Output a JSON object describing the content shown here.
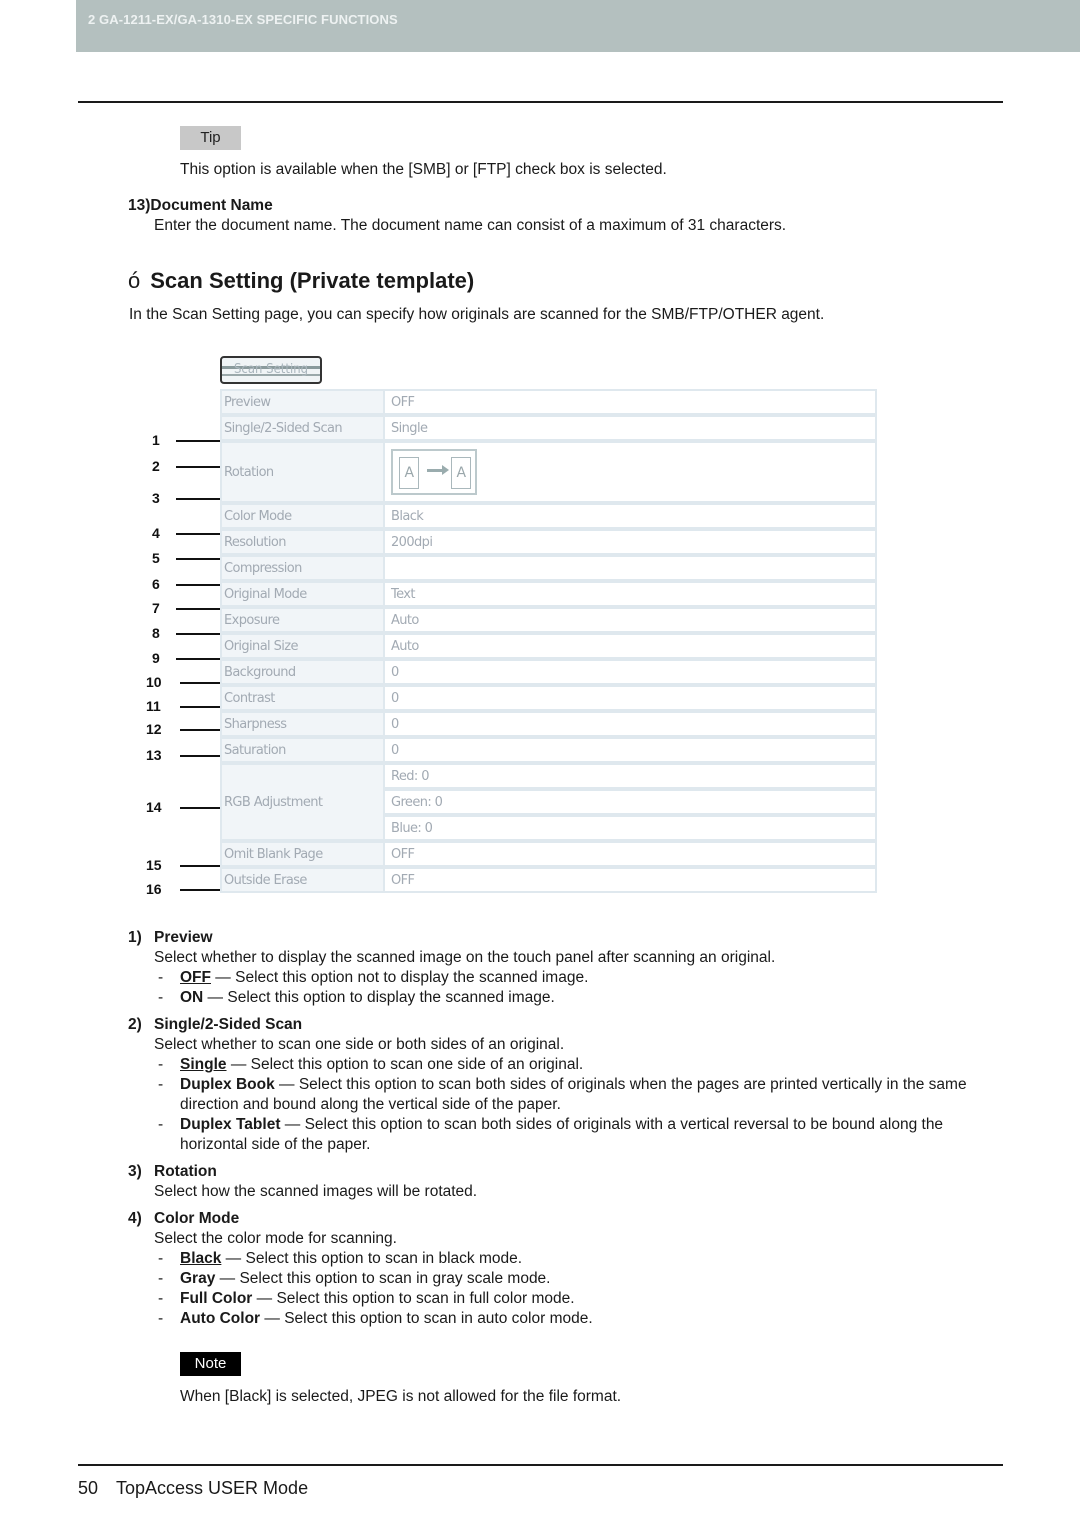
{
  "header": {
    "section_title": "2 GA-1211-EX/GA-1310-EX SPECIFIC FUNCTIONS"
  },
  "tip": {
    "label": "Tip",
    "text": "This option is available when the [SMB] or [FTP] check box is selected."
  },
  "item13": {
    "number": "13)",
    "title": "Document Name",
    "text": "Enter the document name. The document name can consist of a maximum of 31 characters."
  },
  "section": {
    "glyph": "ó",
    "title": "Scan Setting (Private template)",
    "intro": "In the Scan Setting page, you can specify how originals are scanned for the SMB/FTP/OTHER agent."
  },
  "screenshot": {
    "tab_label": "Scan Setting",
    "rows": [
      {
        "label": "Preview",
        "value": "OFF"
      },
      {
        "label": "Single/2-Sided Scan",
        "value": "Single"
      },
      {
        "label": "Rotation",
        "value": "",
        "icon": "rotation-icon",
        "icon_letters": [
          "A",
          "A"
        ]
      },
      {
        "label": "Color Mode",
        "value": "Black"
      },
      {
        "label": "Resolution",
        "value": "200dpi"
      },
      {
        "label": "Compression",
        "value": ""
      },
      {
        "label": "Original Mode",
        "value": "Text"
      },
      {
        "label": "Exposure",
        "value": "Auto"
      },
      {
        "label": "Original Size",
        "value": "Auto"
      },
      {
        "label": "Background",
        "value": "0"
      },
      {
        "label": "Contrast",
        "value": "0"
      },
      {
        "label": "Sharpness",
        "value": "0"
      },
      {
        "label": "Saturation",
        "value": "0"
      },
      {
        "label": "RGB Adjustment",
        "values": [
          "Red: 0",
          "Green: 0",
          "Blue: 0"
        ]
      },
      {
        "label": "Omit Blank Page",
        "value": "OFF"
      },
      {
        "label": "Outside Erase",
        "value": "OFF"
      }
    ],
    "callouts": [
      "1",
      "2",
      "3",
      "4",
      "5",
      "6",
      "7",
      "8",
      "9",
      "10",
      "11",
      "12",
      "13",
      "14",
      "15",
      "16"
    ]
  },
  "descriptions": [
    {
      "number": "1)",
      "title": "Preview",
      "text": "Select whether to display the scanned image on the touch panel after scanning an original.",
      "options": [
        {
          "name": "OFF",
          "default": true,
          "text": " — Select this option not to display the scanned image."
        },
        {
          "name": "ON",
          "default": false,
          "text": " — Select this option to display the scanned image."
        }
      ]
    },
    {
      "number": "2)",
      "title": "Single/2-Sided Scan",
      "text": "Select whether to scan one side or both sides of an original.",
      "options": [
        {
          "name": "Single",
          "default": true,
          "text": " — Select this option to scan one side of an original."
        },
        {
          "name": "Duplex Book",
          "default": false,
          "text": " — Select this option to scan both sides of originals when the pages are printed vertically in the same",
          "cont": "direction and bound along the vertical side of the paper."
        },
        {
          "name": "Duplex Tablet",
          "default": false,
          "text": " — Select this option to scan both sides of originals with a vertical reversal to be bound along the",
          "cont": "horizontal side of the paper."
        }
      ]
    },
    {
      "number": "3)",
      "title": "Rotation",
      "text": "Select how the scanned images will be rotated."
    },
    {
      "number": "4)",
      "title": "Color Mode",
      "text": "Select the color mode for scanning.",
      "options": [
        {
          "name": "Black",
          "default": true,
          "text": " — Select this option to scan in black mode."
        },
        {
          "name": "Gray",
          "default": false,
          "text": " — Select this option to scan in gray scale mode."
        },
        {
          "name": "Full Color",
          "default": false,
          "text": " — Select this option to scan in full color mode."
        },
        {
          "name": "Auto Color",
          "default": false,
          "text": " — Select this option to scan in auto color mode."
        }
      ]
    }
  ],
  "note": {
    "label": "Note",
    "text": "When [Black] is selected, JPEG is not allowed for the file format."
  },
  "footer": {
    "page_number": "50",
    "title": "TopAccess USER Mode"
  },
  "dash": "-"
}
